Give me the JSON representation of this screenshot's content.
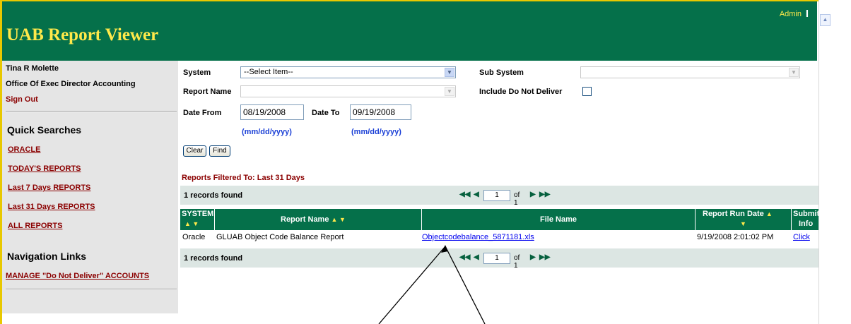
{
  "header": {
    "app_title": "UAB Report Viewer",
    "admin_link": "Admin",
    "separator": "I"
  },
  "sidebar": {
    "user_name": "Tina R Molette",
    "department": "Office Of Exec Director Accounting",
    "sign_out": "Sign Out",
    "quick_searches_title": "Quick Searches",
    "quick_links": [
      "ORACLE",
      "TODAY'S REPORTS",
      "Last 7 Days REPORTS",
      "Last 31 Days REPORTS",
      "ALL REPORTS"
    ],
    "nav_title": "Navigation Links",
    "nav_links": [
      "MANAGE \"Do Not Deliver\" ACCOUNTS"
    ]
  },
  "form": {
    "system_label": "System",
    "system_value": "--Select Item--",
    "sub_system_label": "Sub System",
    "sub_system_value": "",
    "report_name_label": "Report Name",
    "report_name_value": "",
    "include_dnd_label": "Include Do Not Deliver",
    "include_dnd_checked": false,
    "date_from_label": "Date From",
    "date_from_value": "08/19/2008",
    "date_to_label": "Date To",
    "date_to_value": "09/19/2008",
    "date_format_hint": "(mm/dd/yyyy)",
    "clear_button": "Clear",
    "find_button": "Find"
  },
  "results": {
    "filter_text": "Reports Filtered To: Last 31 Days",
    "records_found": "1 records found",
    "page_current": "1",
    "page_of": "of 1",
    "columns": {
      "system": "SYSTEM",
      "report_name": "Report Name",
      "file_name": "File Name",
      "run_date": "Report Run Date",
      "submit_info_1": "Submit",
      "submit_info_2": "Info"
    },
    "rows": [
      {
        "system": "Oracle",
        "report_name": "GLUAB Object Code Balance Report",
        "file_name": "Objectcodebalance_5871181.xls",
        "run_date": "9/19/2008 2:01:02 PM",
        "submit_info": "Click"
      }
    ]
  },
  "colors": {
    "header_green": "#05704a",
    "title_yellow": "#ffe94a",
    "link_red": "#8b0000",
    "pager_bg": "#dce6e3",
    "sidebar_bg": "#e5e5e5"
  }
}
